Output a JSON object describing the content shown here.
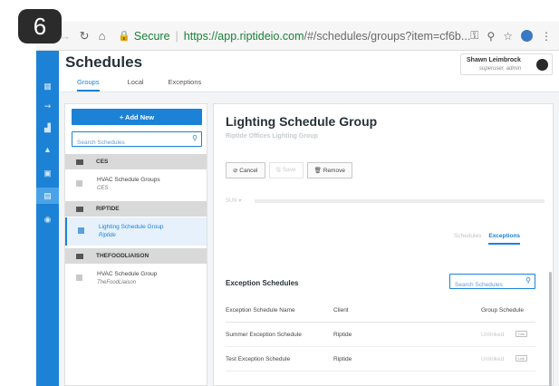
{
  "step_badge": "6",
  "browser": {
    "secure_label": "Secure",
    "url_host": "https://app.riptideio.com",
    "url_path": "/#/schedules/groups?item=cf6b..."
  },
  "header": {
    "title": "Schedules",
    "tabs": [
      {
        "label": "Groups",
        "active": true
      },
      {
        "label": "Local",
        "active": false
      },
      {
        "label": "Exceptions",
        "active": false
      }
    ],
    "user": {
      "name": "Shawn Leimbrock",
      "role": "superuser, admin"
    }
  },
  "left_panel": {
    "add_label": "+ Add New",
    "search_placeholder": "Search Schedules",
    "groups": [
      {
        "header": "CES",
        "items": [
          {
            "title": "HVAC Schedule Groups",
            "subtitle": "CES"
          }
        ]
      },
      {
        "header": "RIPTIDE",
        "items": [
          {
            "title": "Lighting Schedule Group",
            "subtitle": "Riptide",
            "selected": true
          }
        ]
      },
      {
        "header": "THEFOODLIAISON",
        "items": [
          {
            "title": "HVAC Schedule Group",
            "subtitle": "TheFoodLiaison"
          }
        ]
      }
    ]
  },
  "main": {
    "title": "Lighting Schedule Group",
    "subtitle": "Riptide Offices Lighting Group",
    "actions": {
      "cancel": "⊘ Cancel",
      "save": "🖫 Save",
      "remove": "🗑 Remove"
    },
    "sun_label": "SUN ▾",
    "view_tabs": [
      {
        "label": "Schedules",
        "active": false
      },
      {
        "label": "Exceptions",
        "active": true
      }
    ],
    "exceptions": {
      "heading": "Exception Schedules",
      "search_placeholder": "Search Schedules",
      "columns": [
        "Exception Schedule Name",
        "Client",
        "Group Schedule"
      ],
      "rows": [
        {
          "name": "Summer Exception Schedule",
          "client": "Riptide",
          "status": "Unlinked",
          "action": "Link"
        },
        {
          "name": "Test Exception Schedule",
          "client": "Riptide",
          "status": "Unlinked",
          "action": "Link"
        }
      ]
    }
  },
  "colors": {
    "accent": "#1c82d6",
    "sidebar": "#1c82d6",
    "secure": "#188038"
  },
  "icons": {
    "sidebar": [
      "dashboard-icon",
      "graph-icon",
      "chart-icon",
      "alarm-icon",
      "lock-icon",
      "schedule-icon",
      "user-icon"
    ]
  }
}
